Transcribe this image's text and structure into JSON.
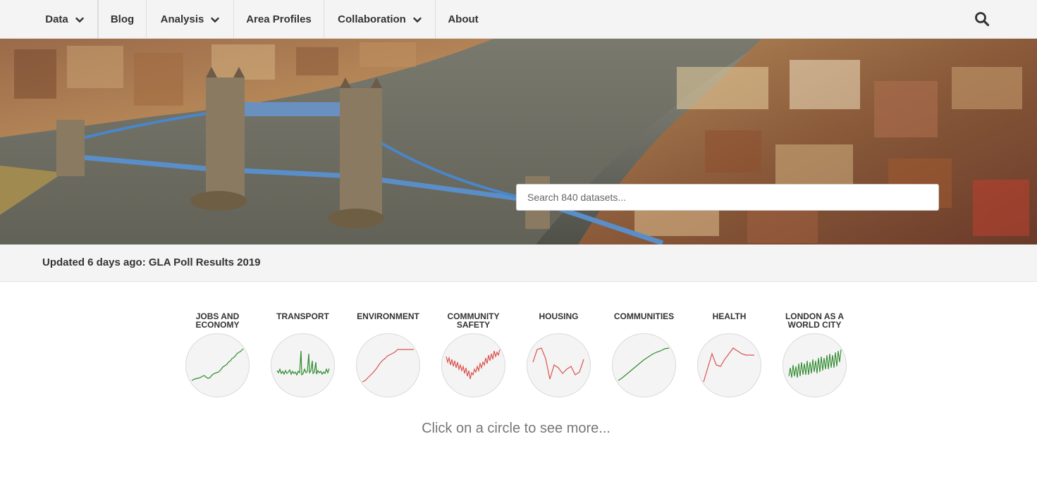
{
  "nav": {
    "items": [
      {
        "label": "Data",
        "has_dropdown": true
      },
      {
        "label": "Blog",
        "has_dropdown": false
      },
      {
        "label": "Analysis",
        "has_dropdown": true
      },
      {
        "label": "Area Profiles",
        "has_dropdown": false
      },
      {
        "label": "Collaboration",
        "has_dropdown": true
      },
      {
        "label": "About",
        "has_dropdown": false
      }
    ],
    "search_icon": "search-icon"
  },
  "hero": {
    "image": "aerial view of Tower Bridge and the River Thames, London",
    "search_placeholder": "Search 840 datasets..."
  },
  "update": {
    "text": "Updated 6 days ago: GLA Poll Results 2019"
  },
  "topics": [
    {
      "label": "Jobs and Economy",
      "line_color": "#2e8b2e",
      "trend": "rising"
    },
    {
      "label": "Transport",
      "line_color": "#2e8b2e",
      "trend": "spiky"
    },
    {
      "label": "Environment",
      "line_color": "#d9534f",
      "trend": "rising-plateau"
    },
    {
      "label": "Community Safety",
      "line_color": "#d9534f",
      "trend": "noisy-dip"
    },
    {
      "label": "Housing",
      "line_color": "#d9534f",
      "trend": "zigzag"
    },
    {
      "label": "Communities",
      "line_color": "#2e8b2e",
      "trend": "smooth-rise"
    },
    {
      "label": "Health",
      "line_color": "#d9534f",
      "trend": "peaks"
    },
    {
      "label": "London as a World City",
      "line_color": "#2e8b2e",
      "trend": "oscillating"
    }
  ],
  "hint": "Click on a circle to see more..."
}
